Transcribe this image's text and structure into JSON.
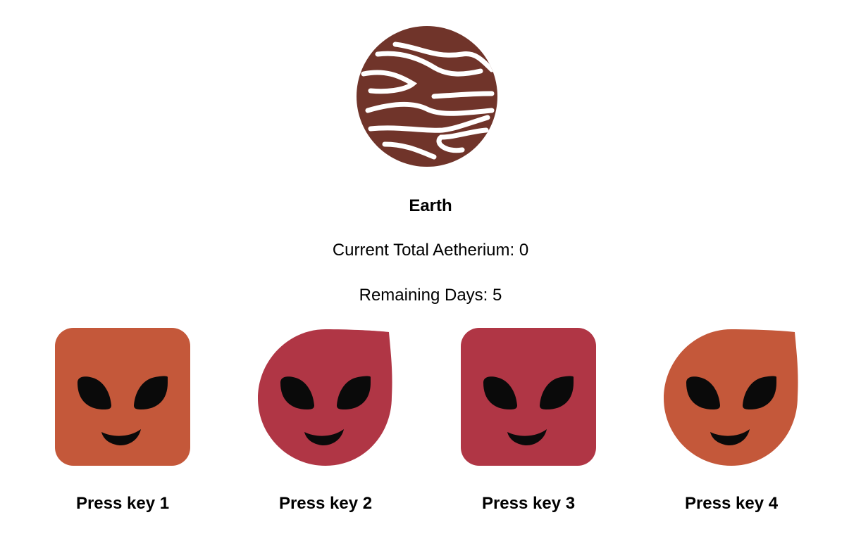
{
  "planet": {
    "name": "Earth",
    "icon": "banded-planet-icon",
    "color": "#70342a",
    "band_color": "#ffffff"
  },
  "stats": {
    "aetherium_text": "Current Total Aetherium: 0",
    "days_text": "Remaining Days: 5"
  },
  "aliens": [
    {
      "shape": "rounded-square",
      "color": "#c4583a",
      "icon": "alien-face-icon",
      "label": "Press key 1"
    },
    {
      "shape": "drop",
      "color": "#b03645",
      "icon": "alien-face-icon",
      "label": "Press key 2"
    },
    {
      "shape": "rounded-square",
      "color": "#b03645",
      "icon": "alien-face-icon",
      "label": "Press key 3"
    },
    {
      "shape": "drop",
      "color": "#c4583a",
      "icon": "alien-face-icon",
      "label": "Press key 4"
    }
  ],
  "face_color": "#0a0a0a"
}
